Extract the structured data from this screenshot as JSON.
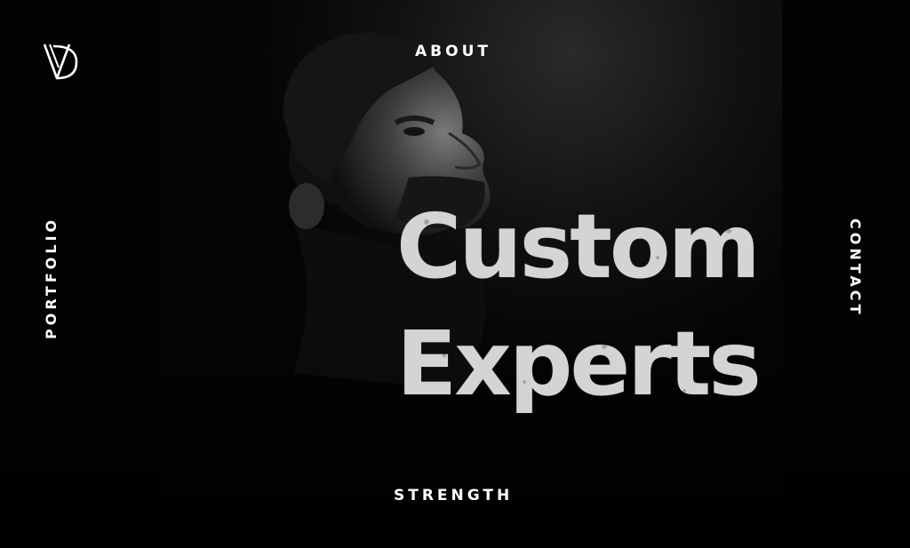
{
  "brand": {
    "logo_icon": "vd-monogram-logo-icon"
  },
  "nav": {
    "top": "ABOUT",
    "left": "PORTFOLIO",
    "right": "CONTACT",
    "bottom": "STRENGTH"
  },
  "hero": {
    "headline_line1": "Custom",
    "headline_line2": "Experts",
    "image_icon": "man-portrait-icon"
  },
  "colors": {
    "background": "#000000",
    "text": "#ffffff",
    "headline": "#d4d4d4"
  }
}
